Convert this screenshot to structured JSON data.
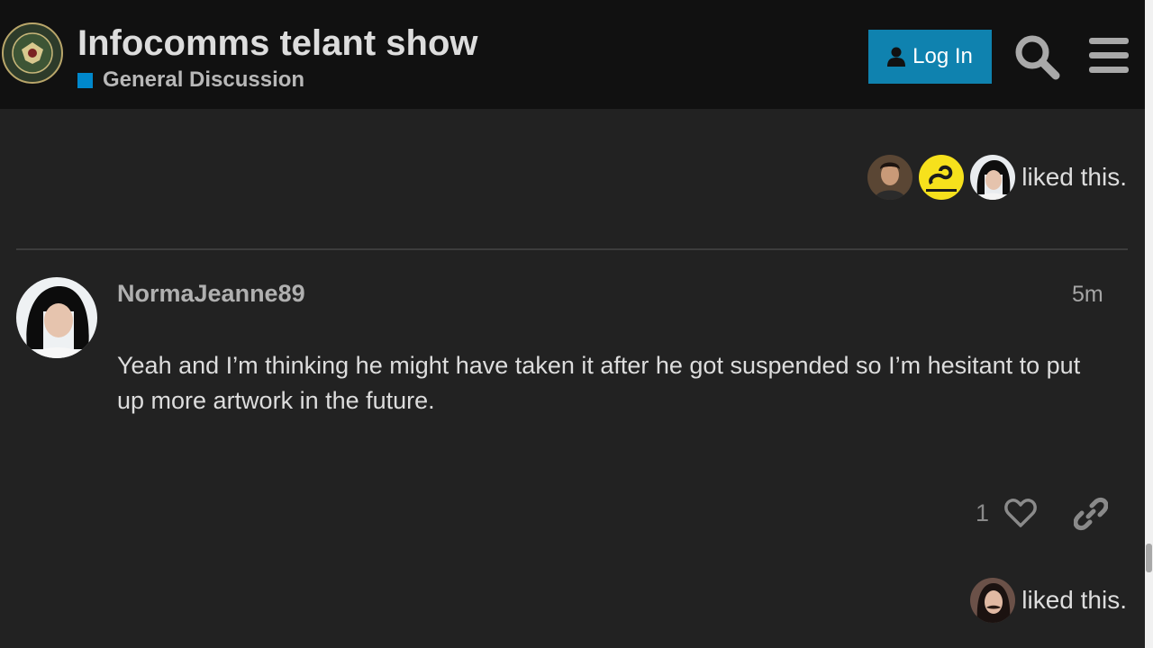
{
  "header": {
    "title": "Infocomms telant show",
    "category": {
      "label": "General Discussion",
      "color": "#0088cc"
    },
    "login_label": "Log In",
    "login_color": "#0f82af",
    "logo_icon": "infowars-army-seal-icon",
    "search_icon": "search-icon",
    "menu_icon": "hamburger-menu-icon"
  },
  "previous_post": {
    "liked_by": [
      "avatar-man",
      "avatar-gadsden-flag",
      "avatar-normajeanne"
    ],
    "liked_text": "liked this."
  },
  "post": {
    "username": "NormaJeanne89",
    "time": "5m",
    "body": "Yeah and I’m thinking he might have taken it after he got suspended so I’m hesitant to put up more artwork in the future.",
    "like_count": "1",
    "liked_by": [
      "avatar-woman-mustache"
    ],
    "liked_text": "liked this."
  }
}
